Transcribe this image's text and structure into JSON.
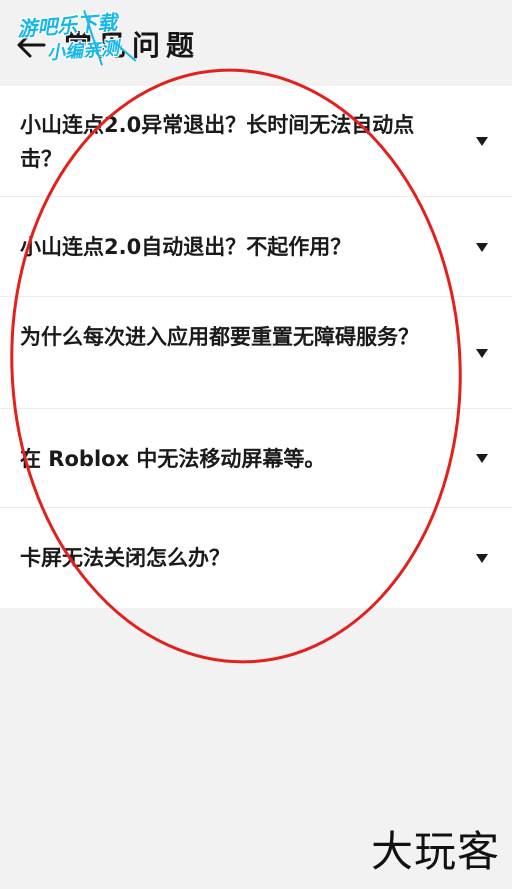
{
  "header": {
    "title": "常见问题"
  },
  "watermark_top": {
    "line1": "游吧乐下载",
    "line2": "小编亲测"
  },
  "faq": [
    {
      "question": "小山连点2.0异常退出？长时间无法自动点击？"
    },
    {
      "question": "小山连点2.0自动退出？不起作用？"
    },
    {
      "question": "为什么每次进入应用都要重置无障碍服务？"
    },
    {
      "question": "在 Roblox 中无法移动屏幕等。"
    },
    {
      "question": "卡屏无法关闭怎么办？"
    }
  ],
  "watermark_bottom": "大玩客",
  "colors": {
    "annotation": "#e4201d",
    "watermark": "#18b7ea"
  },
  "icons": {
    "back": "arrow-left-icon",
    "expand": "caret-down-icon"
  }
}
